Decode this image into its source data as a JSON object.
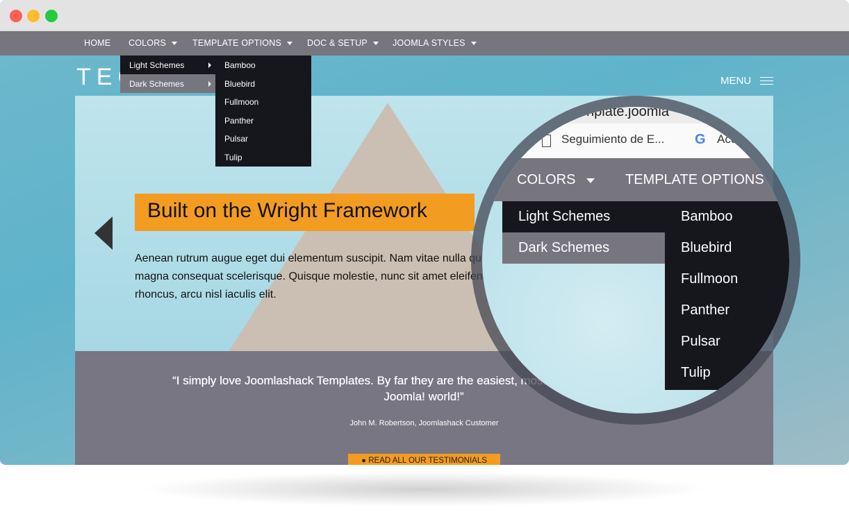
{
  "window": {
    "controls": [
      "close",
      "minimize",
      "maximize"
    ],
    "colors": {
      "close": "#fe5f57",
      "minimize": "#febc2e",
      "maximize": "#28c840"
    }
  },
  "nav": {
    "items": [
      {
        "label": "HOME"
      },
      {
        "label": "COLORS"
      },
      {
        "label": "TEMPLATE OPTIONS"
      },
      {
        "label": "DOC & SETUP"
      },
      {
        "label": "JOOMLA STYLES"
      }
    ]
  },
  "colors_menu": {
    "items": [
      {
        "label": "Light Schemes"
      },
      {
        "label": "Dark Schemes"
      }
    ],
    "selected": "Dark Schemes"
  },
  "schemes_menu": {
    "items": [
      "Bamboo",
      "Bluebird",
      "Fullmoon",
      "Panther",
      "Pulsar",
      "Tulip"
    ]
  },
  "header": {
    "logo": "TEC",
    "menu_label": "MENU"
  },
  "hero": {
    "headline": "Built on the Wright Framework",
    "text": "Aenean rutrum augue eget dui elementum suscipit. Nam vitae nulla quis magna consequat scelerisque. Quisque molestie, nunc sit amet eleifend rhoncus, arcu nisl iaculis elit."
  },
  "testimonial": {
    "quote": "“I simply love Joomlashack Templates. By far they are the easiest, most elegant templates in the Joomla! world!”",
    "quote_visible_line1": "“I simply love Joomlashack Templates. By far they are the easiest, most elega",
    "quote_visible_line2": "Joomla! world!”",
    "author": "John M. Robertson, Joomlashack Customer",
    "cta": "READ ALL OUR TESTIMONIALS"
  },
  "magnifier": {
    "url_fragment": "nplate.joomla",
    "bookmark": "Seguimiento de E...",
    "bookmark2": "Acc",
    "nav": [
      "COLORS",
      "TEMPLATE OPTIONS"
    ],
    "menu": [
      "Light Schemes",
      "Dark Schemes"
    ],
    "schemes": [
      "Bamboo",
      "Bluebird",
      "Fullmoon",
      "Panther",
      "Pulsar",
      "Tulip"
    ]
  },
  "accent": "#f39c22"
}
